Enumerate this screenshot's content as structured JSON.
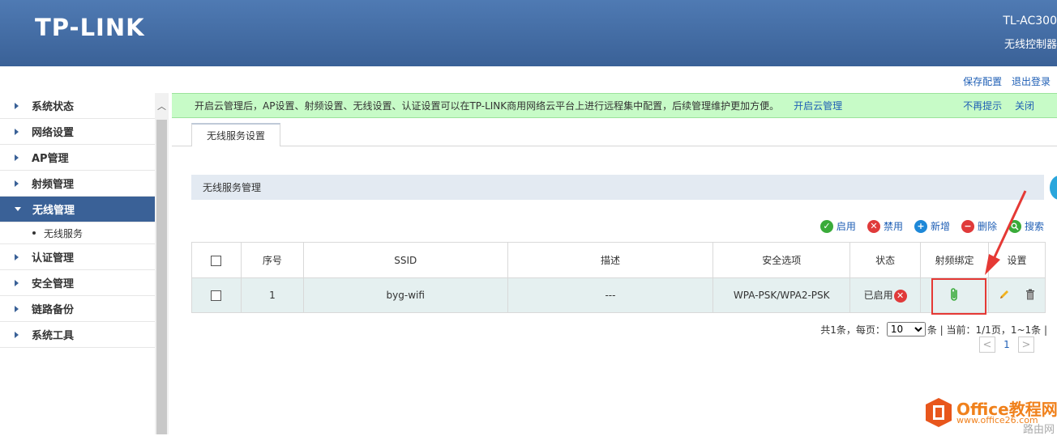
{
  "header": {
    "logo": "TP-LINK",
    "model": "TL-AC300",
    "model_sub": "无线控制器"
  },
  "toplinks": {
    "save": "保存配置",
    "logout": "退出登录"
  },
  "sidebar": {
    "items": [
      {
        "label": "系统状态"
      },
      {
        "label": "网络设置"
      },
      {
        "label": "AP管理"
      },
      {
        "label": "射频管理"
      },
      {
        "label": "无线管理",
        "active": true
      },
      {
        "label": "认证管理"
      },
      {
        "label": "安全管理"
      },
      {
        "label": "链路备份"
      },
      {
        "label": "系统工具"
      }
    ],
    "submenu": "无线服务"
  },
  "notice": {
    "message": "开启云管理后，AP设置、射频设置、无线设置、认证设置可以在TP-LINK商用网络云平台上进行远程集中配置，后续管理维护更加方便。",
    "open_link": "开启云管理",
    "no_remind": "不再提示",
    "close": "关闭"
  },
  "tab": {
    "label": "无线服务设置"
  },
  "section": {
    "title": "无线服务管理"
  },
  "toolbar": {
    "enable": "启用",
    "disable": "禁用",
    "add": "新增",
    "delete": "删除",
    "search": "搜索",
    "colors": {
      "enable": "#3aab3a",
      "disable": "#e03a3a",
      "add": "#1e88d8",
      "delete": "#e03a3a",
      "search": "#3aab3a"
    }
  },
  "table": {
    "headers": {
      "index": "序号",
      "ssid": "SSID",
      "desc": "描述",
      "security": "安全选项",
      "status": "状态",
      "bind": "射频绑定",
      "settings": "设置"
    },
    "rows": [
      {
        "index": "1",
        "ssid": "byg-wifi",
        "desc": "---",
        "security": "WPA-PSK/WPA2-PSK",
        "status": "已启用"
      }
    ]
  },
  "pager": {
    "total": "共1条，每页：",
    "per_page": "10",
    "suffix": "条 | 当前：1/1页，1~1条 |",
    "page": "1",
    "prev": "<",
    "next": ">"
  },
  "watermark": {
    "title": "Office教程网",
    "url": "www.office26.com",
    "extra": "路由网"
  }
}
